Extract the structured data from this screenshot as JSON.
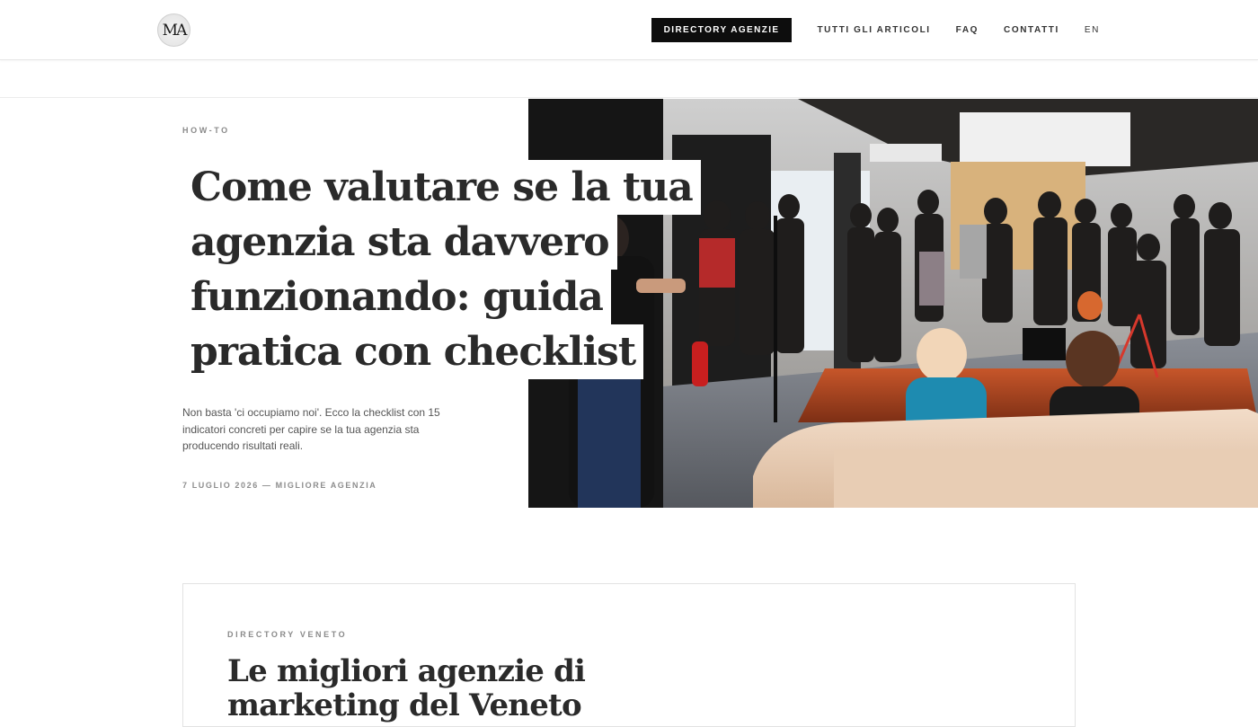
{
  "header": {
    "logo_text": "MA",
    "nav": [
      {
        "label": "DIRECTORY AGENZIE"
      },
      {
        "label": "TUTTI GLI ARTICOLI"
      },
      {
        "label": "FAQ"
      },
      {
        "label": "CONTATTI"
      },
      {
        "label": "EN"
      }
    ]
  },
  "hero": {
    "category": "HOW-TO",
    "title_lines": [
      "Come valutare se la tua",
      "agenzia sta davvero",
      "funzionando: guida",
      "pratica con checklist"
    ],
    "excerpt": "Non basta 'ci occupiamo noi'. Ecco la checklist con 15 indicatori concreti per capire se la tua agenzia sta producendo risultati reali.",
    "meta": "7 LUGLIO 2026 — MIGLIORE AGENZIA",
    "image_alt": "event-photo"
  },
  "card": {
    "category": "DIRECTORY VENETO",
    "title": "Le migliori agenzie di marketing del Veneto"
  }
}
